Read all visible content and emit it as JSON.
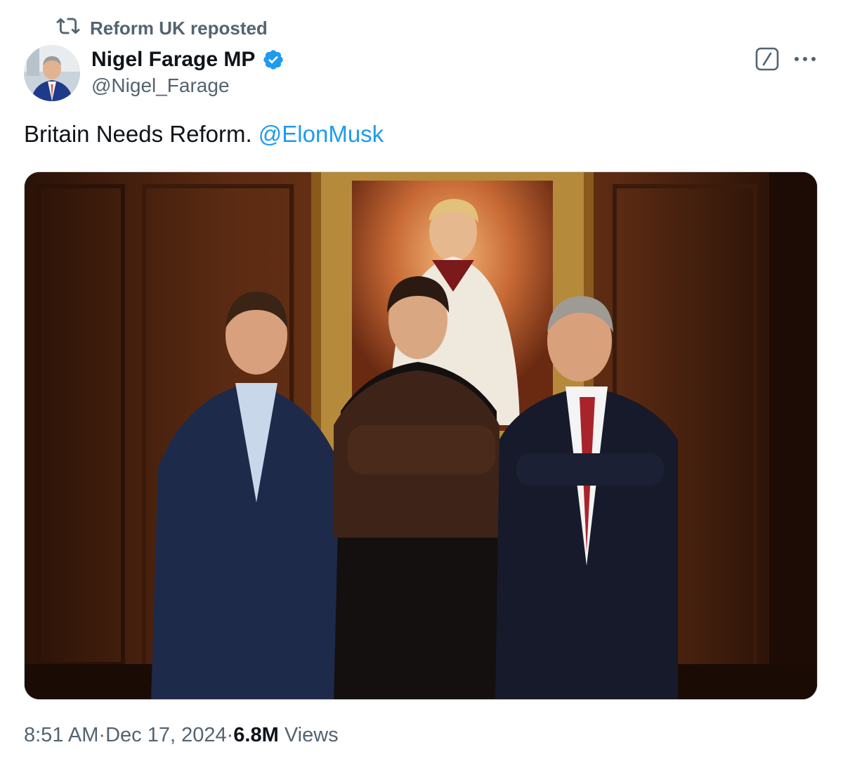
{
  "repost": {
    "text": "Reform UK reposted",
    "icon": "repost-icon"
  },
  "author": {
    "display_name": "Nigel Farage MP",
    "handle": "@Nigel_Farage",
    "verified": true,
    "verified_color": "#1d9bf0"
  },
  "actions": {
    "grok_icon": "grok-icon",
    "more_icon": "more-icon"
  },
  "tweet": {
    "text": "Britain Needs Reform.",
    "mention": "@ElonMusk",
    "mention_color": "#1d9bf0"
  },
  "meta": {
    "time": "8:51 AM",
    "separator": " · ",
    "date": "Dec 17, 2024",
    "views_count": "6.8M",
    "views_label": "Views"
  }
}
